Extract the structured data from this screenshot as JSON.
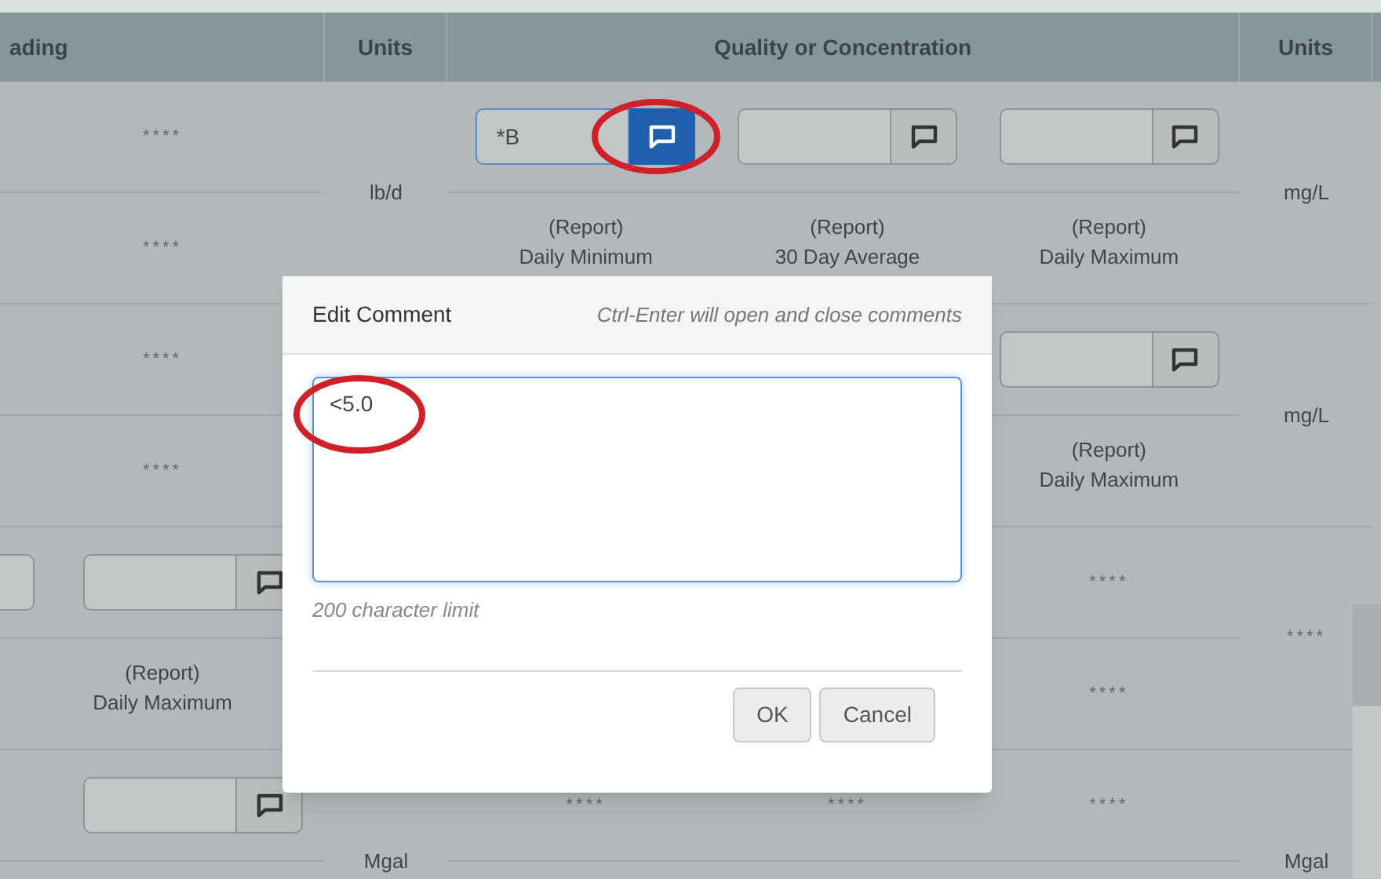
{
  "header": {
    "columns": [
      "ading",
      "Units",
      "Quality or Concentration",
      "Units"
    ]
  },
  "groups": [
    {
      "units": "lb/d",
      "units_2": "mg/L",
      "rows": [
        {
          "reading": {
            "kind": "text",
            "text": "****"
          },
          "quality": {
            "col_1": {
              "kind": "input",
              "value": "*B",
              "comment_active": true
            },
            "col_2": {
              "kind": "input",
              "comment_active": false
            },
            "col_3": {
              "kind": "input",
              "comment_active": false
            }
          }
        },
        {
          "reading": {
            "kind": "text",
            "text": "****"
          },
          "quality": {
            "col_1": {
              "kind": "report",
              "label": "(Report)",
              "statistic": "Daily Minimum"
            },
            "col_2": {
              "kind": "report",
              "label": "(Report)",
              "statistic": "30 Day Average"
            },
            "col_3": {
              "kind": "report",
              "label": "(Report)",
              "statistic": "Daily Maximum"
            }
          }
        }
      ]
    },
    {
      "units_2": "mg/L",
      "rows": [
        {
          "reading": {
            "kind": "text",
            "text": "****"
          },
          "quality": {
            "col_3": {
              "kind": "input",
              "comment_active": false
            }
          }
        },
        {
          "reading": {
            "kind": "text",
            "text": "****"
          },
          "quality": {
            "col_3": {
              "kind": "report",
              "label": "(Report)",
              "statistic": "Daily Maximum"
            }
          }
        }
      ]
    },
    {
      "units_2": "****",
      "rows": [
        {
          "reading": {
            "kind": "input",
            "leading_field": true,
            "comment_active": false
          },
          "quality": {
            "col_3": {
              "kind": "text",
              "text": "****"
            }
          }
        },
        {
          "reading": {
            "kind": "report",
            "label": "(Report)",
            "statistic": "Daily Maximum"
          },
          "quality": {
            "col_3": {
              "kind": "text",
              "text": "****"
            }
          }
        }
      ]
    },
    {
      "units": "Mgal",
      "units_2": "Mgal",
      "rows": [
        {
          "reading": {
            "kind": "input",
            "comment_active": false
          },
          "quality": {
            "col_1": {
              "kind": "text",
              "text": "****"
            },
            "col_2": {
              "kind": "text",
              "text": "****"
            },
            "col_3": {
              "kind": "text",
              "text": "****"
            }
          }
        }
      ]
    }
  ],
  "dialog": {
    "title": "Edit Comment",
    "hint": "Ctrl-Enter will open and close comments",
    "comment": "<5.0",
    "limit_note": "200 character limit",
    "buttons": [
      "OK",
      "Cancel"
    ]
  }
}
